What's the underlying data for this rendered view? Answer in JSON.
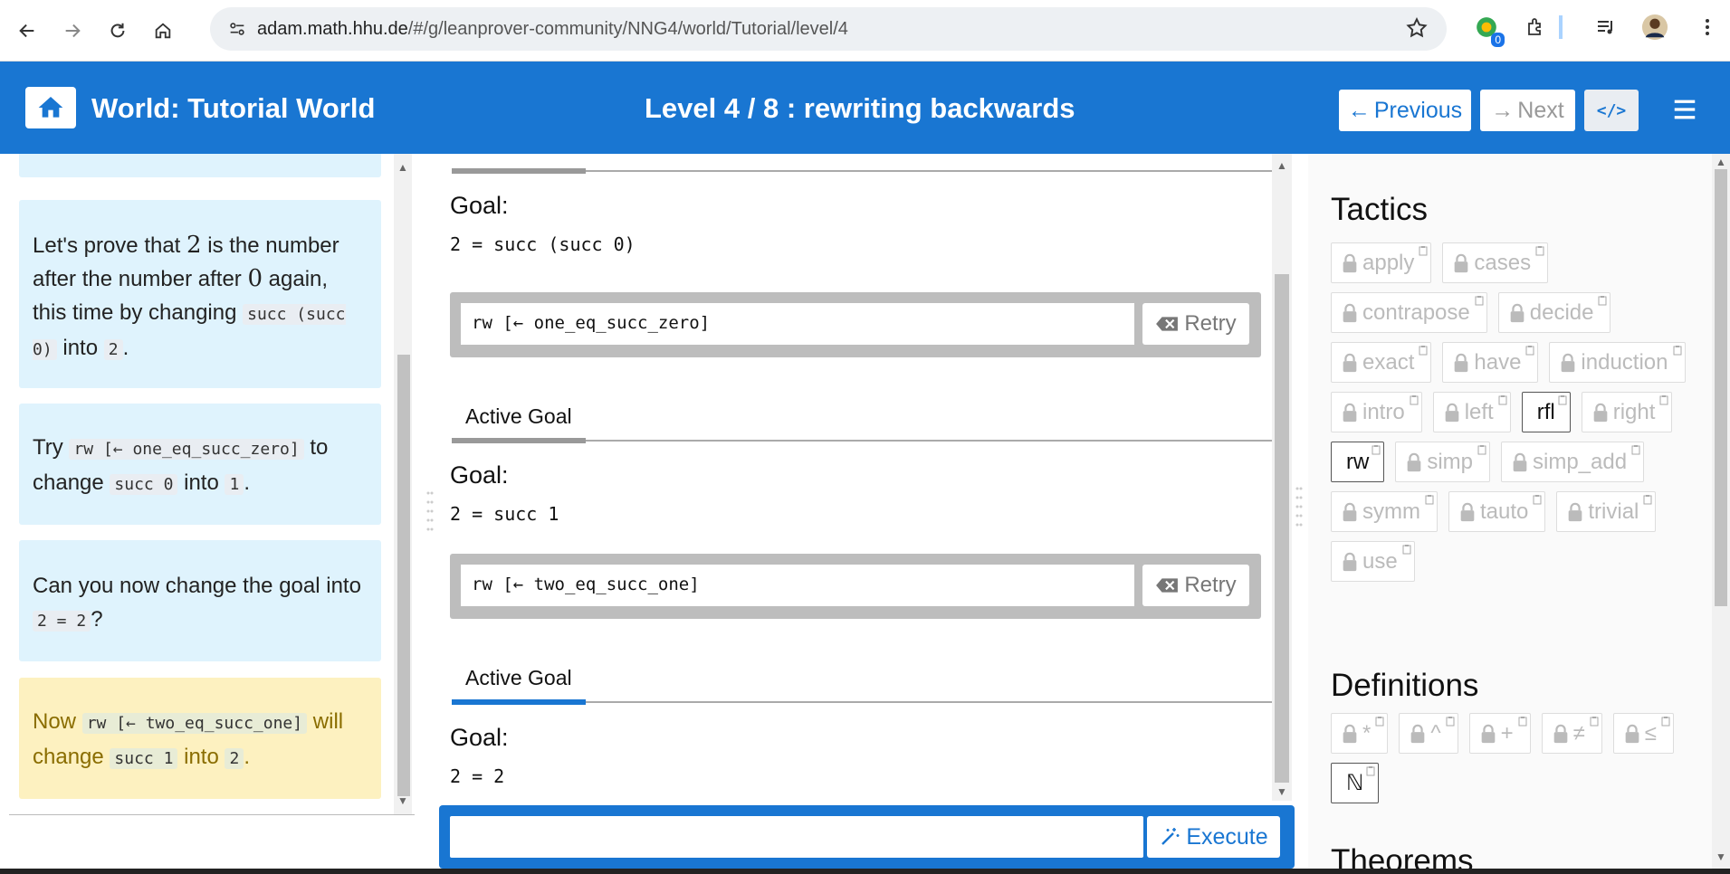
{
  "browser": {
    "url_host": "adam.math.hhu.de",
    "url_path": "/#/g/leanprover-community/NNG4/world/Tutorial/level/4",
    "extension_badge": "0"
  },
  "header": {
    "world_title": "World: Tutorial World",
    "level_title": "Level 4 / 8 : rewriting backwards",
    "prev_label": "Previous",
    "next_label": "Next",
    "code_label": "</>",
    "accent_color": "#1976d2"
  },
  "intro": {
    "msg1": {
      "pre": "Let's prove that ",
      "math1": "2",
      "mid1": " is the number after the number after ",
      "math2": "0",
      "mid2": " again, this time by changing ",
      "code1": "succ (succ 0)",
      "mid3": " into ",
      "code2": "2",
      "post": "."
    },
    "msg2": {
      "pre": "Try ",
      "code1": "rw [← one_eq_succ_zero]",
      "mid1": " to change ",
      "code2": "succ 0",
      "mid2": " into ",
      "code3": "1",
      "post": "."
    },
    "msg3": {
      "pre": "Can you now change the goal into ",
      "code1": "2 = 2",
      "post": "?"
    },
    "msg4": {
      "pre": "Now ",
      "code1": "rw [← two_eq_succ_one]",
      "mid1": " will change ",
      "code2": "succ 1",
      "mid2": " into ",
      "code3": "2",
      "post": "."
    }
  },
  "proof": {
    "tab_label": "Active Goal",
    "goal_label": "Goal:",
    "goal1": "2 = succ (succ 0)",
    "cmd1": "rw [← one_eq_succ_zero]",
    "goal2": "2 = succ 1",
    "cmd2": "rw [← two_eq_succ_one]",
    "goal3": "2 = 2",
    "retry_label": "Retry",
    "execute_label": "Execute",
    "command_input_value": ""
  },
  "inventory": {
    "tactics_title": "Tactics",
    "tactics": [
      {
        "label": "apply",
        "locked": true
      },
      {
        "label": "cases",
        "locked": true
      },
      {
        "label": "contrapose",
        "locked": true
      },
      {
        "label": "decide",
        "locked": true
      },
      {
        "label": "exact",
        "locked": true
      },
      {
        "label": "have",
        "locked": true
      },
      {
        "label": "induction",
        "locked": true
      },
      {
        "label": "intro",
        "locked": true
      },
      {
        "label": "left",
        "locked": true
      },
      {
        "label": "rfl",
        "locked": false
      },
      {
        "label": "right",
        "locked": true
      },
      {
        "label": "rw",
        "locked": false
      },
      {
        "label": "simp",
        "locked": true
      },
      {
        "label": "simp_add",
        "locked": true
      },
      {
        "label": "symm",
        "locked": true
      },
      {
        "label": "tauto",
        "locked": true
      },
      {
        "label": "trivial",
        "locked": true
      },
      {
        "label": "use",
        "locked": true
      }
    ],
    "definitions_title": "Definitions",
    "definitions": [
      {
        "label": "*",
        "locked": true
      },
      {
        "label": "^",
        "locked": true
      },
      {
        "label": "+",
        "locked": true
      },
      {
        "label": "≠",
        "locked": true
      },
      {
        "label": "≤",
        "locked": true
      },
      {
        "label": "ℕ",
        "locked": false
      }
    ],
    "theorems_title": "Theorems"
  }
}
